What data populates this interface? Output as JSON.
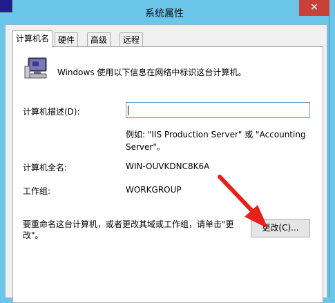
{
  "window": {
    "title": "系统属性",
    "close_label": "✕"
  },
  "tabs": [
    {
      "label": "计算机名"
    },
    {
      "label": "硬件"
    },
    {
      "label": "高级"
    },
    {
      "label": "远程"
    }
  ],
  "panel": {
    "intro": "Windows 使用以下信息在网络中标识这台计算机。",
    "description_label": "计算机描述(D):",
    "description_value": "",
    "example_line1": "例如: \"IIS Production Server\" 或 \"Accounting",
    "example_line2": "Server\"。",
    "fullname_label": "计算机全名:",
    "fullname_value": "WIN-OUVKDNC8K6A",
    "workgroup_label": "工作组:",
    "workgroup_value": "WORKGROUP",
    "rename_line1": "要重命名这台计算机，或者更改其域或工作组，请单击\"更",
    "rename_line2": "改\"。",
    "change_button": "更改(C)..."
  },
  "colors": {
    "titlebar": "#6cc6ea",
    "close": "#c7403a",
    "annotation_arrow": "#e8201a"
  },
  "icons": {
    "computer": "computer-icon",
    "close": "close-icon"
  }
}
